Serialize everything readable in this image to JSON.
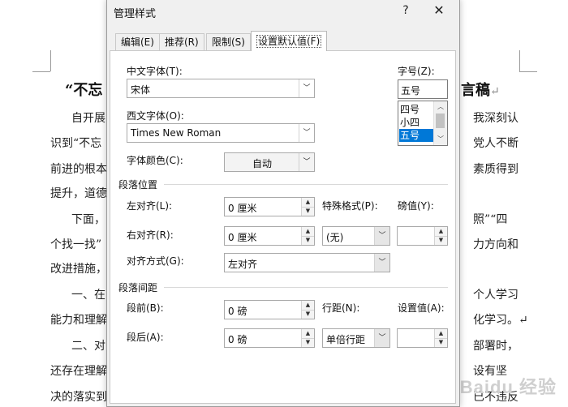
{
  "document": {
    "title_left": "“不忘",
    "title_right": "言稿",
    "lines": [
      {
        "left": "自开展",
        "right": "我深刻认"
      },
      {
        "left": "识到“不忘",
        "right": "党人不断"
      },
      {
        "left": "前进的根本",
        "right": "素质得到"
      },
      {
        "left": "提升，道德",
        "right": ""
      },
      {
        "left": "下面，",
        "right": "照”“四"
      },
      {
        "left": "个找一找”",
        "right": "力方向和"
      },
      {
        "left": "改进措施，",
        "right": ""
      },
      {
        "left": "一、在",
        "right": "个人学习"
      },
      {
        "left": "能力和理解",
        "right": "化学习。↵"
      },
      {
        "left": "二、对",
        "right": "部署时，"
      },
      {
        "left": "还存在理解",
        "right": "设有坚"
      },
      {
        "left": "决的落实到",
        "right": "已不违反"
      }
    ],
    "paragraph_mark": "↵",
    "watermark": "Baidu 经验"
  },
  "dialog": {
    "title": "管理样式",
    "help_glyph": "?",
    "close_glyph": "✕",
    "tabs": [
      "编辑(E)",
      "推荐(R)",
      "限制(S)",
      "设置默认值(F)"
    ],
    "active_tab": 3,
    "chinese_font": {
      "label": "中文字体(T):",
      "value": "宋体"
    },
    "western_font": {
      "label": "西文字体(O):",
      "value": "Times New Roman"
    },
    "font_color": {
      "label": "字体颜色(C):",
      "value": "自动"
    },
    "font_size": {
      "label": "字号(Z):",
      "value": "五号",
      "options": [
        "四号",
        "小四",
        "五号"
      ],
      "selected_index": 2
    },
    "paragraph_position": {
      "section_label": "段落位置",
      "left_indent": {
        "label": "左对齐(L):",
        "value": "0 厘米"
      },
      "right_indent": {
        "label": "右对齐(R):",
        "value": "0 厘米"
      },
      "special_format": {
        "label": "特殊格式(P):",
        "value": "(无)"
      },
      "special_value": {
        "label": "磅值(Y):",
        "value": ""
      },
      "alignment": {
        "label": "对齐方式(G):",
        "value": "左对齐"
      }
    },
    "paragraph_spacing": {
      "section_label": "段落间距",
      "before": {
        "label": "段前(B):",
        "value": "0 磅"
      },
      "after": {
        "label": "段后(A):",
        "value": "0 磅"
      },
      "line_spacing": {
        "label": "行距(N):",
        "value": "单倍行距"
      },
      "set_value": {
        "label": "设置值(A):",
        "value": ""
      }
    }
  },
  "icons": {
    "dropdown": "chevron-down-icon",
    "spin_up": "spin-up-icon",
    "spin_down": "spin-down-icon"
  },
  "colors": {
    "selection": "#0078d7",
    "dialog_bg": "#f0f0f0",
    "panel_bg": "#ffffff"
  }
}
